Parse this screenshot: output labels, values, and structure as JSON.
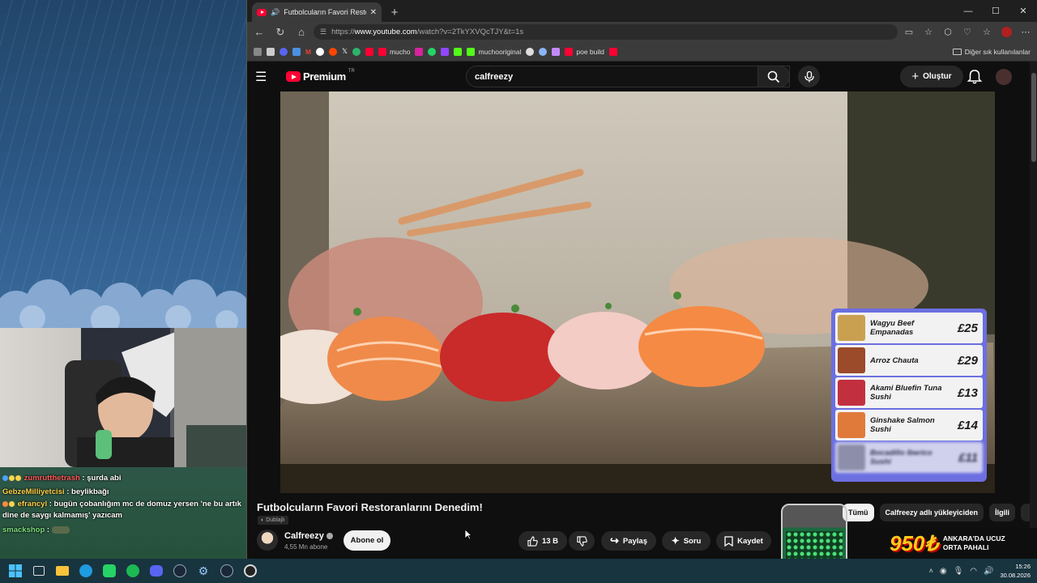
{
  "stream": {
    "chat": [
      {
        "user": "zumrutthetrash",
        "message": "şurda abi"
      },
      {
        "user": "GebzeMilliyetcisi",
        "message": "beylikbağı"
      },
      {
        "user": "efrancyl",
        "message": "bugün çobanlığım mc de domuz yersen 'ne bu artık dine de saygı kalmamış' yazıcam"
      },
      {
        "user": "smackshop",
        "message": ""
      }
    ]
  },
  "browser": {
    "tab_title": "Futbolcuların Favori Restoranl",
    "url_prefix": "https://",
    "url_host": "www.youtube.com",
    "url_path": "/watch?v=2TkYXVQcTJY&t=1s",
    "bookmarks": [
      "mucho",
      "muchooriginal",
      "poe build"
    ],
    "other_bookmarks": "Diğer sık kullanılanlar"
  },
  "youtube": {
    "logo_text": "Premium",
    "logo_region": "TR",
    "search_value": "calfreezy",
    "create_label": "Oluştur",
    "video": {
      "menu": [
        {
          "name": "Wagyu Beef Empanadas",
          "price": "£25",
          "color": "#c9a050"
        },
        {
          "name": "Arroz Chauta",
          "price": "£29",
          "color": "#9b4a2a"
        },
        {
          "name": "Akami Bluefin Tuna Sushi",
          "price": "£13",
          "color": "#c23040"
        },
        {
          "name": "Ginshake Salmon Sushi",
          "price": "£14",
          "color": "#e07a3a"
        },
        {
          "name": "Bocadillo Iberico Sushi",
          "price": "£11",
          "color": "#999999"
        }
      ]
    },
    "title": "Futbolcuların Favori Restoranlarını Denedim!",
    "dub_badge": "Dublajlı",
    "channel_name": "Calfreezy",
    "channel_subs": "4,55 Mn abone",
    "subscribe_label": "Abone ol",
    "like_count": "13 B",
    "share_label": "Paylaş",
    "ask_label": "Soru",
    "save_label": "Kaydet",
    "chips": [
      "Tümü",
      "Calfreezy adlı yükleyiciden",
      "İlgili"
    ]
  },
  "overlay_ad": {
    "price": "950₺",
    "text_line1": "ANKARA'DA UCUZ",
    "text_line2": "ORTA PAHALI"
  },
  "taskbar": {
    "time": "15:26",
    "date": "30.08.2026"
  }
}
